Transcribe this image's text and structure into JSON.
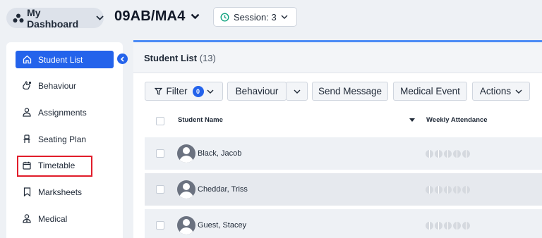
{
  "header": {
    "dashboard_label": "My Dashboard",
    "class_title": "09AB/MA4",
    "session_label": "Session: 3"
  },
  "sidebar": {
    "items": [
      {
        "label": "Student List",
        "icon": "home-icon",
        "active": true
      },
      {
        "label": "Behaviour",
        "icon": "thumbs-icon",
        "active": false
      },
      {
        "label": "Assignments",
        "icon": "person-icon",
        "active": false
      },
      {
        "label": "Seating Plan",
        "icon": "chair-icon",
        "active": false
      },
      {
        "label": "Timetable",
        "icon": "calendar-icon",
        "active": false
      },
      {
        "label": "Marksheets",
        "icon": "bookmark-icon",
        "active": false
      },
      {
        "label": "Medical",
        "icon": "medical-person-icon",
        "active": false
      }
    ]
  },
  "main": {
    "title": "Student List",
    "count": "(13)",
    "toolbar": {
      "filter_label": "Filter",
      "filter_count": "0",
      "behaviour_label": "Behaviour",
      "send_message_label": "Send Message",
      "medical_event_label": "Medical Event",
      "actions_label": "Actions"
    },
    "columns": {
      "student_name": "Student Name",
      "weekly_attendance": "Weekly Attendance"
    },
    "students": [
      {
        "name": "Black, Jacob"
      },
      {
        "name": "Cheddar, Triss"
      },
      {
        "name": "Guest, Stacey"
      }
    ]
  },
  "colors": {
    "accent": "#2463eb",
    "highlight": "#e11d2b",
    "panel_top_border": "#4b8bf5"
  }
}
